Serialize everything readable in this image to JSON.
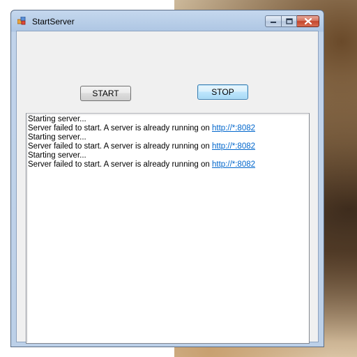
{
  "window": {
    "title": "StartServer",
    "app_icon": "windows-form-icon",
    "caption": {
      "minimize_icon": "minimize-icon",
      "maximize_icon": "maximize-icon",
      "close_icon": "close-icon"
    }
  },
  "buttons": {
    "start_label": "START",
    "stop_label": "STOP"
  },
  "log": {
    "lines": [
      {
        "text": "Starting server...",
        "link": ""
      },
      {
        "text": "Server failed to start. A server is already running on ",
        "link": "http://*:8082"
      },
      {
        "text": "Starting server...",
        "link": ""
      },
      {
        "text": "Server failed to start. A server is already running on ",
        "link": "http://*:8082"
      },
      {
        "text": "Starting server...",
        "link": ""
      },
      {
        "text": "Server failed to start. A server is already running on ",
        "link": "http://*:8082"
      }
    ]
  },
  "colors": {
    "link": "#0066cc",
    "close_button": "#c4452c"
  }
}
